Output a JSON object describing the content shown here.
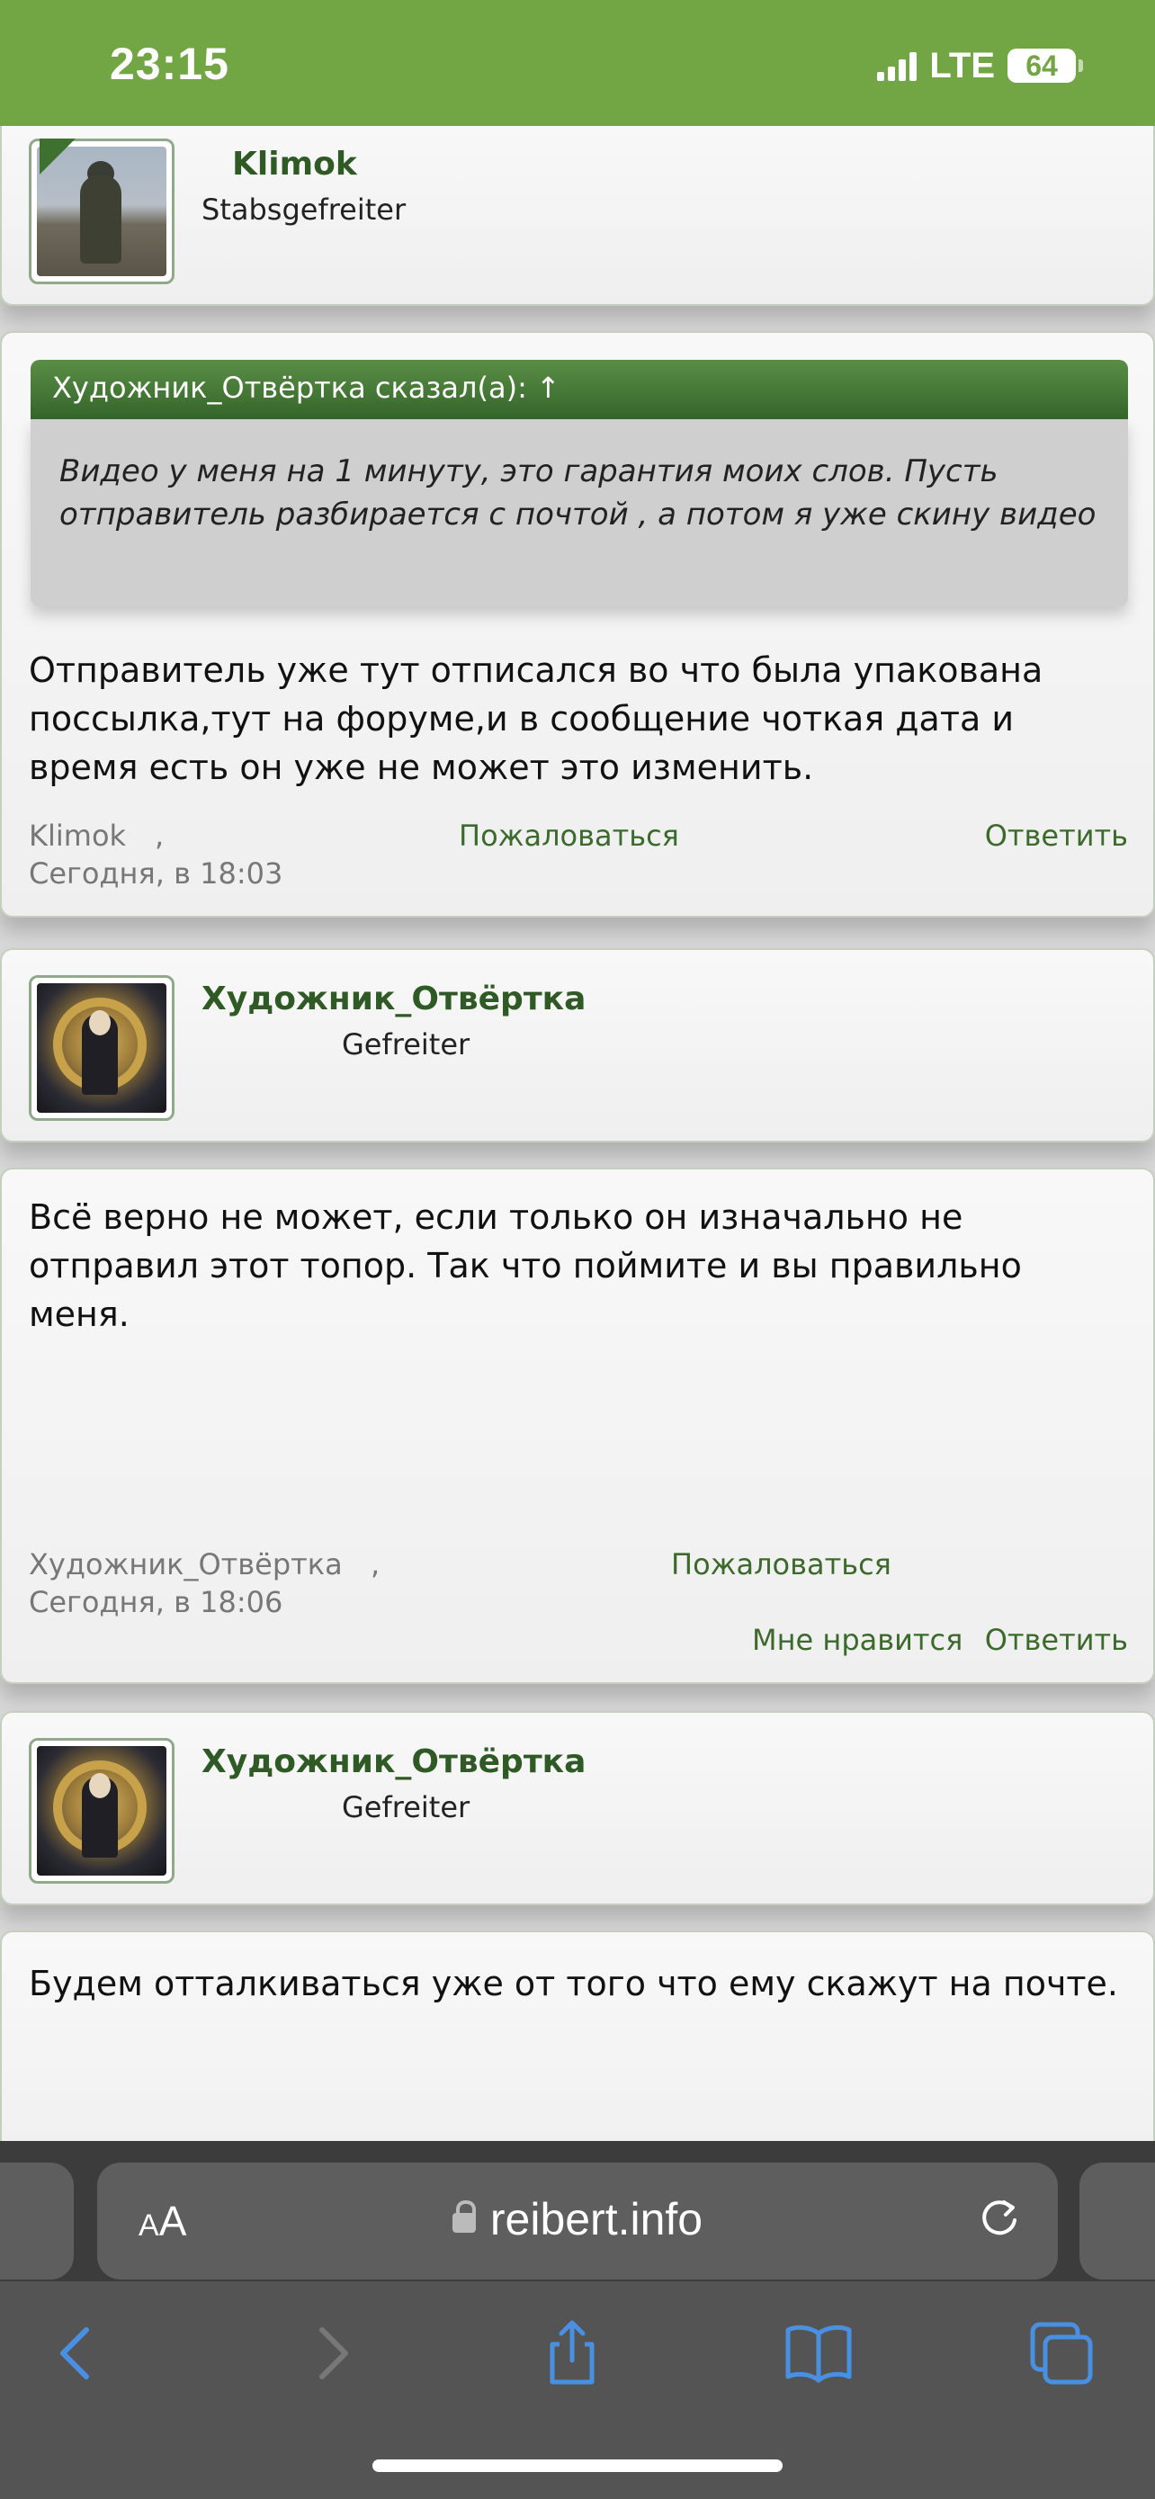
{
  "status_bar": {
    "time": "23:15",
    "network": "LTE",
    "battery": "64"
  },
  "posts": [
    {
      "author_card": {
        "name": "Klimok",
        "rank": "Stabsgefreiter"
      },
      "quote": {
        "header": "Художник_Отвёртка сказал(а): ↑",
        "text": "Видео у меня на 1 минуту, это гарантия моих слов. Пусть отправитель разбирается с почтой , а потом я уже скину видео"
      },
      "text": "Отправитель уже тут отписался во что была упакована поссылка,тут на форуме,и в сообщение чоткая дата и время есть он уже не может это изменить.",
      "author": "Klimok",
      "separator": ",",
      "date": "Сегодня, в 18:03",
      "report": "Пожаловаться",
      "reply": "Ответить"
    },
    {
      "author_card": {
        "name": "Художник_Отвёртка",
        "rank": "Gefreiter"
      },
      "text": "Всё верно не может, если только он изначально не отправил этот топор. Так что поймите и вы правильно меня.",
      "author": "Художник_Отвёртка",
      "separator": ",",
      "date": "Сегодня, в 18:06",
      "report": "Пожаловаться",
      "like": "Мне нравится",
      "reply": "Ответить"
    },
    {
      "author_card": {
        "name": "Художник_Отвёртка",
        "rank": "Gefreiter"
      },
      "text": "Будем отталкиваться уже от того что ему скажут на почте."
    }
  ],
  "browser": {
    "text_size": "AA",
    "url": "reibert.info"
  },
  "colors": {
    "accent": "#72a543",
    "username": "#2f5a25",
    "quote_header": "#3e7030"
  }
}
